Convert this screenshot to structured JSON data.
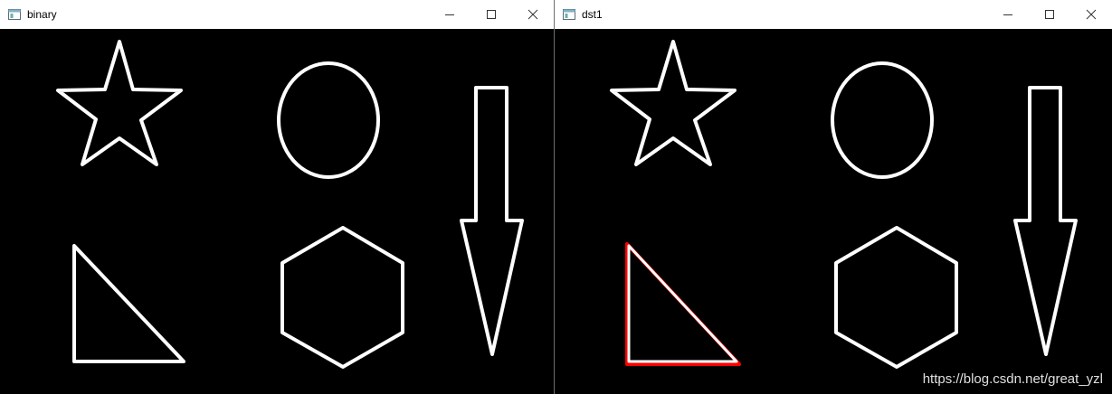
{
  "windows": {
    "left": {
      "title": "binary",
      "shapes": [
        "star",
        "ellipse",
        "arrow",
        "triangle",
        "hexagon"
      ]
    },
    "right": {
      "title": "dst1",
      "shapes": [
        "star",
        "ellipse",
        "arrow",
        "triangle",
        "hexagon"
      ],
      "highlighted_shape": "triangle"
    }
  },
  "window_controls": {
    "minimize_icon": "minimize-icon",
    "maximize_icon": "maximize-icon",
    "close_icon": "close-icon"
  },
  "colors": {
    "background": "#000000",
    "shape_stroke": "#ffffff",
    "highlight_stroke": "#ff0000"
  },
  "watermark": "https://blog.csdn.net/great_yzl"
}
